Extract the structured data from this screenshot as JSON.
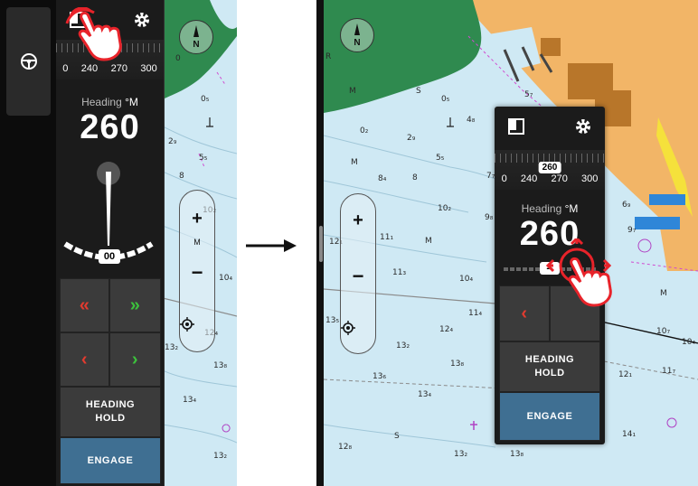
{
  "left": {
    "tape": {
      "labels": [
        "0",
        "240",
        "270",
        "300"
      ]
    },
    "heading_label": "Heading",
    "heading_unit": "°M",
    "heading_value": "260",
    "rudder_value": "00",
    "buttons": {
      "port_double": "«",
      "stbd_double": "»",
      "port_single": "‹",
      "stbd_single": "›",
      "heading_hold": "HEADING HOLD",
      "engage": "ENGAGE"
    },
    "zoom": {
      "plus": "+",
      "mode": "M",
      "minus": "−"
    },
    "compass_label": "N",
    "depths": [
      {
        "t": "0",
        "l": 14,
        "tp": 60
      },
      {
        "t": "0₅",
        "l": 42,
        "tp": 105
      },
      {
        "t": "2₉",
        "l": 6,
        "tp": 152
      },
      {
        "t": "5₅",
        "l": 40,
        "tp": 170
      },
      {
        "t": "8",
        "l": 18,
        "tp": 190
      },
      {
        "t": "10₂",
        "l": 44,
        "tp": 228
      },
      {
        "t": "10₄",
        "l": 62,
        "tp": 303
      },
      {
        "t": "12₄",
        "l": 46,
        "tp": 364
      },
      {
        "t": "13₂",
        "l": 2,
        "tp": 380
      },
      {
        "t": "13₈",
        "l": 56,
        "tp": 400
      },
      {
        "t": "13₄",
        "l": 22,
        "tp": 438
      },
      {
        "t": "13₂",
        "l": 56,
        "tp": 500
      }
    ]
  },
  "right": {
    "tape": {
      "labels": [
        "0",
        "240",
        "270",
        "300"
      ],
      "badge": "260"
    },
    "heading_label": "Heading",
    "heading_unit": "°M",
    "heading_value": "260",
    "rudder_value": "--",
    "buttons": {
      "port_single": "‹",
      "heading_hold": "HEADING HOLD",
      "engage": "ENGAGE"
    },
    "zoom": {
      "plus": "+",
      "minus": "−"
    },
    "compass_label": "N",
    "depths": [
      {
        "t": "R",
        "l": 2,
        "tp": 58
      },
      {
        "t": "M",
        "l": 28,
        "tp": 96
      },
      {
        "t": "S",
        "l": 102,
        "tp": 96
      },
      {
        "t": "0₅",
        "l": 130,
        "tp": 105
      },
      {
        "t": "4₈",
        "l": 158,
        "tp": 128
      },
      {
        "t": "0₂",
        "l": 40,
        "tp": 140
      },
      {
        "t": "2₉",
        "l": 92,
        "tp": 148
      },
      {
        "t": "5₅",
        "l": 124,
        "tp": 170
      },
      {
        "t": "M",
        "l": 30,
        "tp": 175
      },
      {
        "t": "8₄",
        "l": 60,
        "tp": 193
      },
      {
        "t": "8",
        "l": 98,
        "tp": 192
      },
      {
        "t": "7₇",
        "l": 180,
        "tp": 190
      },
      {
        "t": "10₂",
        "l": 126,
        "tp": 226
      },
      {
        "t": "9₈",
        "l": 178,
        "tp": 236
      },
      {
        "t": "12₁",
        "l": 6,
        "tp": 263
      },
      {
        "t": "11₁",
        "l": 62,
        "tp": 258
      },
      {
        "t": "M",
        "l": 112,
        "tp": 262
      },
      {
        "t": "11₃",
        "l": 76,
        "tp": 297
      },
      {
        "t": "10₄",
        "l": 150,
        "tp": 304
      },
      {
        "t": "11₄",
        "l": 160,
        "tp": 342
      },
      {
        "t": "13₅",
        "l": 2,
        "tp": 350
      },
      {
        "t": "12₄",
        "l": 128,
        "tp": 360
      },
      {
        "t": "13₂",
        "l": 80,
        "tp": 378
      },
      {
        "t": "13₈",
        "l": 140,
        "tp": 398
      },
      {
        "t": "13₆",
        "l": 54,
        "tp": 412
      },
      {
        "t": "13₄",
        "l": 104,
        "tp": 432
      },
      {
        "t": "S",
        "l": 78,
        "tp": 478
      },
      {
        "t": "12₈",
        "l": 16,
        "tp": 490
      },
      {
        "t": "13₂",
        "l": 144,
        "tp": 498
      },
      {
        "t": "13₈",
        "l": 206,
        "tp": 498
      },
      {
        "t": "5₇",
        "l": 222,
        "tp": 100
      },
      {
        "t": "6₉",
        "l": 330,
        "tp": 222
      },
      {
        "t": "9₇",
        "l": 336,
        "tp": 250
      },
      {
        "t": "M",
        "l": 372,
        "tp": 320
      },
      {
        "t": "10₇",
        "l": 368,
        "tp": 362
      },
      {
        "t": "10₄",
        "l": 396,
        "tp": 374
      },
      {
        "t": "12₁",
        "l": 326,
        "tp": 410
      },
      {
        "t": "11₇",
        "l": 374,
        "tp": 406
      },
      {
        "t": "14₁",
        "l": 330,
        "tp": 476
      }
    ]
  }
}
